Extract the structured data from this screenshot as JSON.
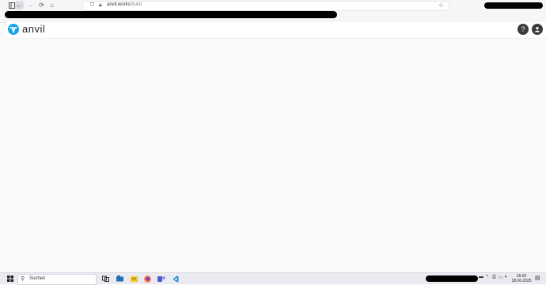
{
  "browser": {
    "url_domain": "anvil.works",
    "url_path": "/build",
    "icons": [
      "sidebar-icon",
      "back-icon",
      "forward-icon",
      "reload-icon",
      "home-icon",
      "shield-icon",
      "lock-icon",
      "star-icon"
    ]
  },
  "app": {
    "logo_text": "anvil",
    "help_glyph": "?",
    "brand_color": "#1aa3e8"
  },
  "taskbar": {
    "search_label": "Suchen",
    "time": "16:02",
    "date": "18.06.2025",
    "apps": [
      "task-view-icon",
      "file-explorer-icon",
      "store-icon",
      "firefox-icon",
      "teams-icon",
      "vscode-icon"
    ]
  }
}
